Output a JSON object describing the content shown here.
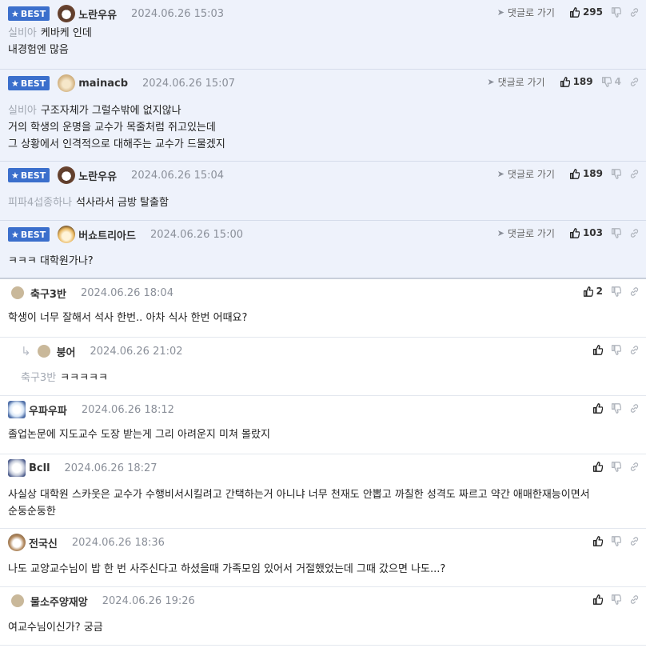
{
  "best_badge": "BEST",
  "reply_link_label": "댓글로 가기",
  "comments": [
    {
      "best": true,
      "nickname": "노란우유",
      "avatar": "bear-avatar",
      "date": "2024.06.26 15:03",
      "likes": "295",
      "dislikes": "",
      "target": "실비아",
      "lines": [
        "케바케 인데",
        "내경험엔 많음"
      ]
    },
    {
      "best": true,
      "nickname": "mainacb",
      "avatar": "dog-avatar",
      "date": "2024.06.26 15:07",
      "likes": "189",
      "dislikes": "4",
      "target": "실비아",
      "lines": [
        "구조자체가 그럴수밖에 없지않나",
        "거의 학생의 운명을 교수가 목줄처럼 쥐고있는데",
        "그 상황에서 인격적으로 대해주는 교수가 드물겠지"
      ]
    },
    {
      "best": true,
      "nickname": "노란우유",
      "avatar": "bear-avatar",
      "date": "2024.06.26 15:04",
      "likes": "189",
      "dislikes": "",
      "target": "피파4섭종하나",
      "lines": [
        "석사라서 금방 탈출함"
      ]
    },
    {
      "best": true,
      "nickname": "버쇼트리아드",
      "avatar": "fox-avatar",
      "date": "2024.06.26 15:00",
      "likes": "103",
      "dislikes": "",
      "target": "",
      "lines": [
        "ㅋㅋㅋ 대학원가나?"
      ]
    },
    {
      "best": false,
      "nickname": "축구3반",
      "avatar": "blob-avatar",
      "date": "2024.06.26 18:04",
      "likes": "2",
      "dislikes": "",
      "target": "",
      "lines": [
        "학생이 너무 잘해서 석사 한번.. 아차 식사 한번 어때요?"
      ]
    },
    {
      "best": false,
      "reply": true,
      "nickname": "붕어",
      "avatar": "blob-avatar",
      "date": "2024.06.26 21:02",
      "likes": "",
      "dislikes": "",
      "target": "축구3반",
      "lines": [
        "ㅋㅋㅋㅋㅋ"
      ]
    },
    {
      "best": false,
      "nickname": "우파우파",
      "avatar": "pom-avatar",
      "date": "2024.06.26 18:12",
      "likes": "",
      "dislikes": "",
      "target": "",
      "lines": [
        "졸업논문에 지도교수 도장 받는게 그리 아려운지 미쳐 몰랐지"
      ]
    },
    {
      "best": false,
      "nickname": "Bcll",
      "avatar": "rabbit-avatar",
      "date": "2024.06.26 18:27",
      "likes": "",
      "dislikes": "",
      "target": "",
      "lines": [
        "사실상 대학원 스카웃은 교수가 수행비서시킬려고 간택하는거 아니냐 너무 천재도 안뽑고 까칠한 성격도 짜르고 약간 애매한재능이면서",
        "순둥순둥한"
      ]
    },
    {
      "best": false,
      "nickname": "전국신",
      "avatar": "otter-avatar",
      "date": "2024.06.26 18:36",
      "likes": "",
      "dislikes": "",
      "target": "",
      "lines": [
        "나도 교양교수님이 밥 한 번 사주신다고 하셨을때 가족모임 있어서 거절했었는데 그때 갔으면 나도...?"
      ]
    },
    {
      "best": false,
      "nickname": "물소주양재앙",
      "avatar": "blob-avatar",
      "date": "2024.06.26 19:26",
      "likes": "",
      "dislikes": "",
      "target": "",
      "lines": [
        "여교수님이신가? 궁금"
      ]
    }
  ]
}
